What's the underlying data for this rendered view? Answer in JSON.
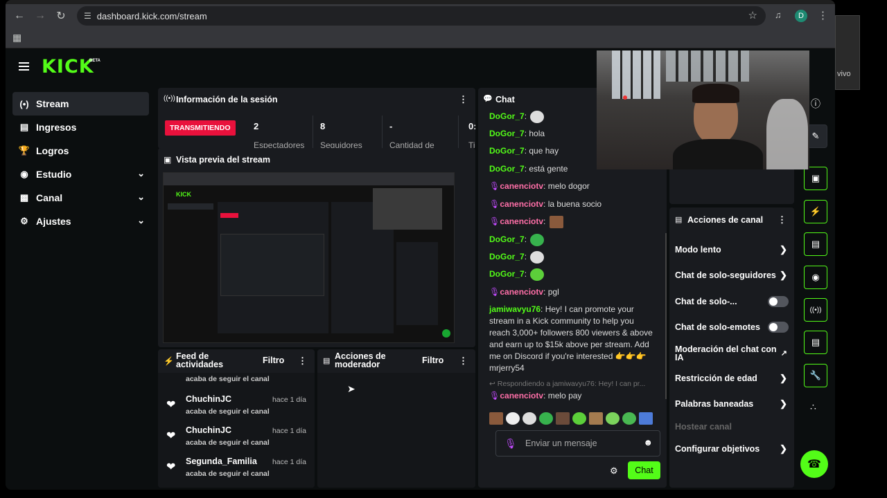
{
  "browser": {
    "url": "dashboard.kick.com/stream",
    "profile_initial": "D"
  },
  "brand": {
    "logo": "KICK",
    "beta": "BETA",
    "accent": "#53fc18"
  },
  "sidebar": {
    "items": [
      {
        "label": "Stream",
        "icon": "broadcast-icon",
        "active": true
      },
      {
        "label": "Ingresos",
        "icon": "chart-icon"
      },
      {
        "label": "Logros",
        "icon": "trophy-icon"
      },
      {
        "label": "Estudio",
        "icon": "studio-icon",
        "expandable": true
      },
      {
        "label": "Canal",
        "icon": "channel-icon",
        "expandable": true
      },
      {
        "label": "Ajustes",
        "icon": "gear-icon",
        "expandable": true
      }
    ]
  },
  "session": {
    "title": "Información de la sesión",
    "status": "TRANSMITIENDO",
    "stats": [
      {
        "num": "2",
        "label": "Espectadores"
      },
      {
        "num": "8",
        "label": "Seguidores"
      },
      {
        "num": "-",
        "label": "Cantidad de"
      },
      {
        "num": "0:",
        "label": "Ti"
      }
    ]
  },
  "preview": {
    "title": "Vista previa del stream"
  },
  "feed": {
    "title": "Feed de actividades",
    "filter": "Filtro",
    "top_text": "acaba de seguir el canal",
    "items": [
      {
        "user": "ChuchinJC",
        "time": "hace 1 día",
        "desc": "acaba de seguir el canal"
      },
      {
        "user": "ChuchinJC",
        "time": "hace 1 día",
        "desc": "acaba de seguir el canal"
      },
      {
        "user": "Segunda_Familia",
        "time": "hace 1 día",
        "desc": "acaba de seguir el canal"
      }
    ]
  },
  "moderator": {
    "title": "Acciones de moderador",
    "filter": "Filtro"
  },
  "chat": {
    "title": "Chat",
    "messages": [
      {
        "user": "DoGor_7",
        "text": "",
        "color": "green",
        "emote": true
      },
      {
        "user": "DoGor_7",
        "text": "hola",
        "color": "green"
      },
      {
        "user": "DoGor_7",
        "text": "que hay",
        "color": "green"
      },
      {
        "user": "DoGor_7",
        "text": "está gente",
        "color": "green"
      },
      {
        "user": "canenciotv",
        "text": "melo dogor",
        "color": "pink"
      },
      {
        "user": "canenciotv",
        "text": "la buena socio",
        "color": "pink"
      },
      {
        "user": "canenciotv",
        "text": "",
        "color": "pink",
        "emote": true
      },
      {
        "user": "DoGor_7",
        "text": "",
        "color": "green",
        "emote": true
      },
      {
        "user": "DoGor_7",
        "text": "",
        "color": "green",
        "emote": true
      },
      {
        "user": "DoGor_7",
        "text": "",
        "color": "green",
        "emote": true
      },
      {
        "user": "canenciotv",
        "text": "pgl",
        "color": "pink"
      }
    ],
    "long_message": {
      "user": "jamiwavyu76",
      "text": "Hey! I can promote your stream in a Kick community to help you reach 3,000+ followers 800 viewers & above and earn up to $15k above per stream. Add me on Discord if you're interested 👉👉👉 mrjerry54"
    },
    "reply_to": "Respondiendo a jamiwavyu76: Hey! I can pr...",
    "reply": {
      "user": "canenciotv",
      "text": "melo pay"
    },
    "input_placeholder": "Enviar un mensaje",
    "send_label": "Chat"
  },
  "channel_actions": {
    "title": "Acciones de canal",
    "items": [
      {
        "label": "Modo lento",
        "kind": "chevron"
      },
      {
        "label": "Chat de solo-seguidores",
        "kind": "chevron"
      },
      {
        "label": "Chat de solo-...",
        "kind": "toggle"
      },
      {
        "label": "Chat de solo-emotes",
        "kind": "toggle"
      },
      {
        "label": "Moderación del chat con IA",
        "kind": "external"
      },
      {
        "label": "Restricción de edad",
        "kind": "chevron"
      },
      {
        "label": "Palabras baneadas",
        "kind": "chevron"
      },
      {
        "label": "Hostear canal",
        "kind": "disabled"
      },
      {
        "label": "Configurar objetivos",
        "kind": "chevron"
      }
    ]
  },
  "background_window_text": "vivo"
}
